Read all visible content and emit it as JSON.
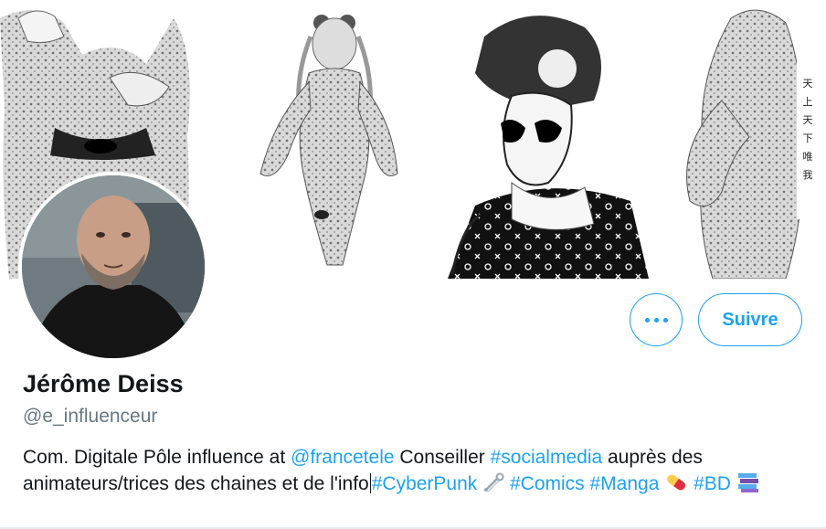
{
  "profile": {
    "name": "Jérôme Deiss",
    "handle": "@e_influenceur",
    "follow_label": "Suivre"
  },
  "bio": {
    "t1": "Com. Digitale Pôle influence at ",
    "mention": "@francetele",
    "t2": " Conseiller ",
    "tag_socialmedia": "#socialmedia",
    "t3": " auprès des animateurs/trices des chaines et de l'info",
    "tag_cyberpunk": "#CyberPunk",
    "tag_comics": "#Comics",
    "tag_manga": "#Manga",
    "tag_bd": "#BD"
  },
  "icons": {
    "more": "more-options-icon",
    "safety_pin": "safety-pin-emoji",
    "pill": "pill-emoji",
    "books": "books-emoji"
  },
  "colors": {
    "accent": "#1da1f2",
    "text": "#14171a",
    "secondary_text": "#657786"
  }
}
